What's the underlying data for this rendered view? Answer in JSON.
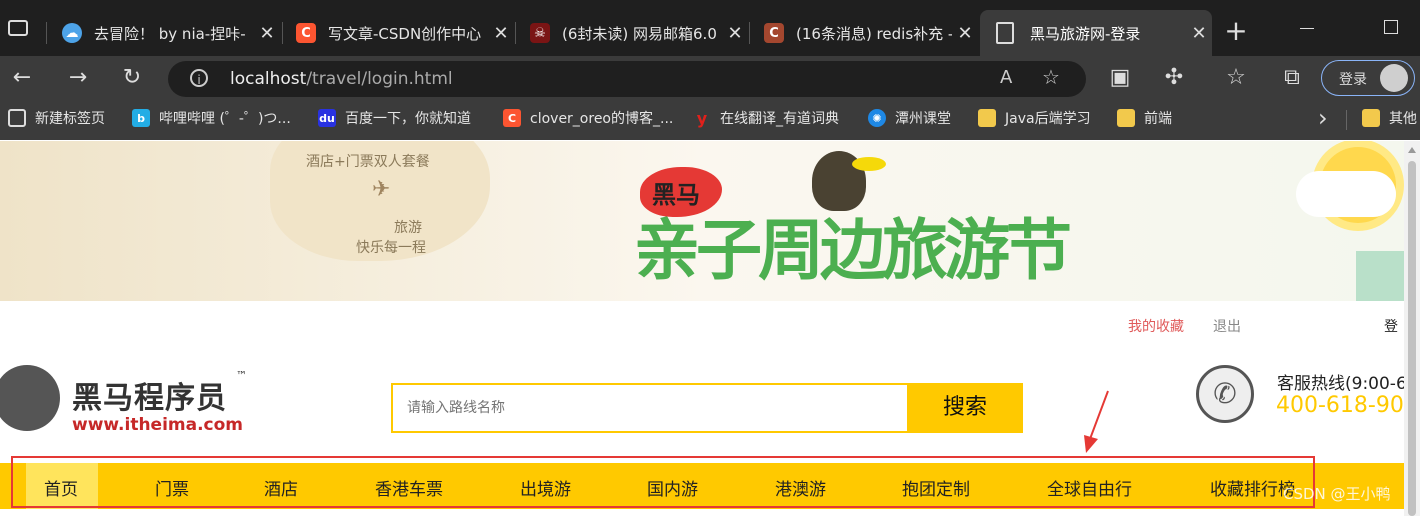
{
  "browser": {
    "tabs": [
      {
        "title": "去冒险！ by nia-捏咔-",
        "icon": "cloud-icon",
        "color": "#4da3e8"
      },
      {
        "title": "写文章-CSDN创作中心",
        "icon": "csdn-icon",
        "color": "#fc5531"
      },
      {
        "title": "(6封未读) 网易邮箱6.0",
        "icon": "netease-mail-icon",
        "color": "#c62828"
      },
      {
        "title": "(16条消息) redis补充 -",
        "icon": "csdn-icon",
        "color": "#a4472f"
      },
      {
        "title": "黑马旅游网-登录",
        "icon": "document-icon",
        "color": "#3b3b3b"
      }
    ],
    "close_glyph": "✕",
    "new_tab_glyph": "+",
    "address": {
      "host": "localhost",
      "path": "/travel/login.html"
    },
    "profile_button": "登录",
    "bookmarks": [
      {
        "label": "新建标签页",
        "icon": "new-tab-icon",
        "color": "#555555"
      },
      {
        "label": "哔哩哔哩 (゜-゜)つ...",
        "icon": "bilibili-icon",
        "color": "#23ade5"
      },
      {
        "label": "百度一下，你就知道",
        "icon": "baidu-icon",
        "color": "#2932e1"
      },
      {
        "label": "clover_oreo的博客_...",
        "icon": "csdn-icon",
        "color": "#fc5531"
      },
      {
        "label": "在线翻译_有道词典",
        "icon": "youdao-icon",
        "color": "#e0201b"
      },
      {
        "label": "潭州课堂",
        "icon": "tanzhou-icon",
        "color": "#1e88e5"
      },
      {
        "label": "Java后端学习",
        "icon": "folder-icon",
        "color": "#f2c94c"
      },
      {
        "label": "前端",
        "icon": "folder-icon",
        "color": "#f2c94c"
      }
    ],
    "bookmarks_more_glyph": "›",
    "other_bookmarks": "其他"
  },
  "banner": {
    "badge_text": "黑马",
    "headline": "亲子周边旅游节",
    "card_line1": "酒店+门票双人套餐",
    "card_line2": "旅游",
    "card_line3": "快乐每一程"
  },
  "header": {
    "favorites_link": "我的收藏",
    "logout_link": "退出",
    "cut_login": "登"
  },
  "logo": {
    "name": "黑马程序员",
    "tm": "™",
    "url": "www.itheima.com"
  },
  "search": {
    "placeholder": "请输入路线名称",
    "button": "搜索"
  },
  "hotline": {
    "label": "客服热线(9:00-6",
    "number": "400-618-90"
  },
  "nav": [
    "首页",
    "门票",
    "酒店",
    "香港车票",
    "出境游",
    "国内游",
    "港澳游",
    "抱团定制",
    "全球自由行",
    "收藏排行榜"
  ],
  "watermark": "CSDN @王小鸭",
  "colors": {
    "accent": "#ffc900",
    "annotation_red": "#e53935",
    "link_red": "#e05a5a"
  }
}
